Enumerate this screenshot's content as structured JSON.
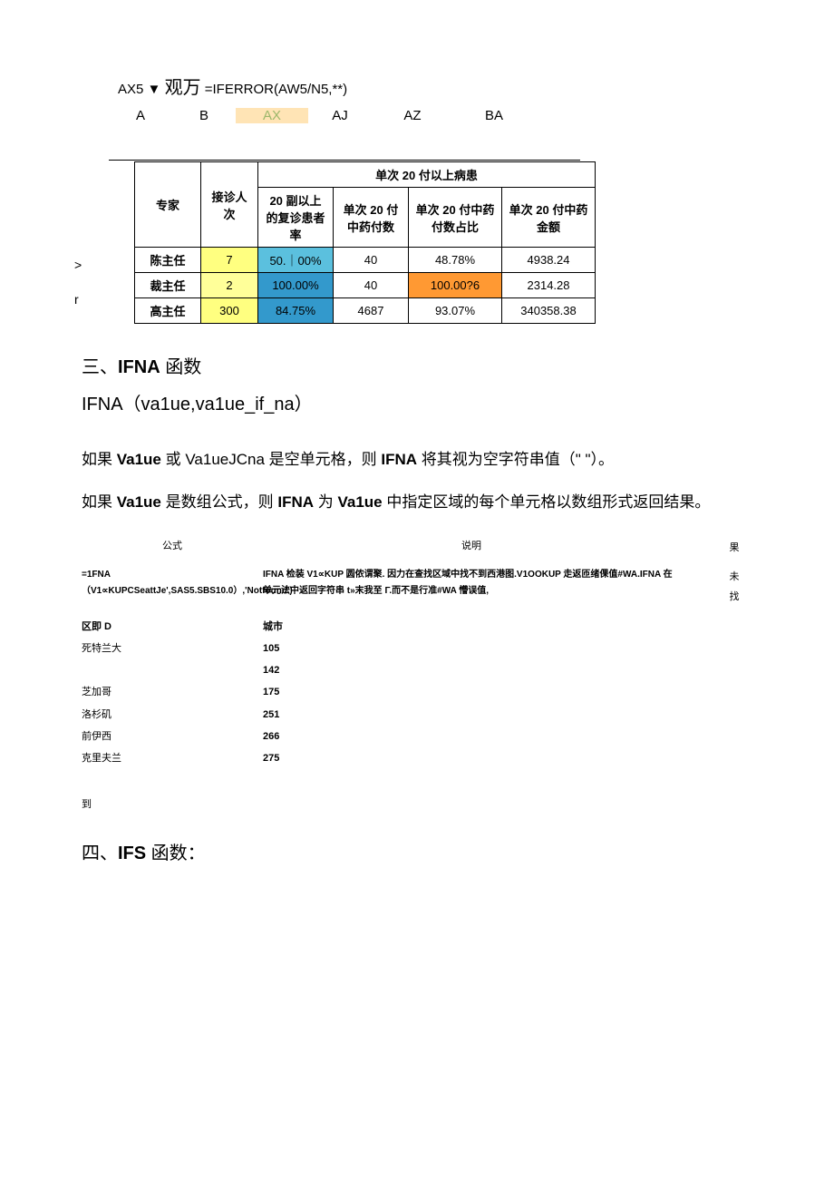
{
  "formula": {
    "cell": "AX5",
    "arrow": "▼",
    "wan_text": "观万",
    "expr": "=IFERROR(AW5/N5,**)"
  },
  "col_headers": {
    "a": "A",
    "b": "B",
    "ax": "AX",
    "aj": "AJ",
    "az": "AZ",
    "ba": "BA"
  },
  "table": {
    "group_header": "单次 20 付以上病患",
    "h_expert": "专家",
    "h_visits": "接诊人次",
    "h_rate20": "20 副以上的复诊患者率",
    "h_times20": "单次 20 付中药付数",
    "h_pct20": "单次 20 付中药付数占比",
    "h_amt20": "单次 20 付中药金额",
    "row_markers": [
      "",
      ">",
      "r"
    ],
    "rows": [
      {
        "expert": "陈主任",
        "visits": "7",
        "rate": "50.｜00%",
        "times": "40",
        "pct": "48.78%",
        "amt": "4938.24"
      },
      {
        "expert": "裁主任",
        "visits": "2",
        "rate": "100.00%",
        "times": "40",
        "pct": "100.00?6",
        "amt": "2314.28"
      },
      {
        "expert": "高主任",
        "visits": "300",
        "rate": "84.75%",
        "times": "4687",
        "pct": "93.07%",
        "amt": "340358.38"
      }
    ]
  },
  "sec3_title_prefix": "三、",
  "sec3_title_bold": "IFNA",
  "sec3_title_suffix": " 函数",
  "sec3_syntax": "IFNA（va1ue,va1ue_if_na）",
  "para1_a": "如果 ",
  "para1_b": "Va1ue",
  "para1_c": " 或 Va1ueJCna 是空单元格，则 ",
  "para1_d": "IFNA",
  "para1_e": " 将其视为空字符串值（\" \"）。",
  "para2_a": "如果 ",
  "para2_b": "Va1ue",
  "para2_c": " 是数组公式，则 ",
  "para2_d": "IFNA",
  "para2_e": " 为 ",
  "para2_f": "Va1ue",
  "para2_g": " 中指定区域的每个单元格以数组形式返回结果。",
  "ifna": {
    "h_formula": "公式",
    "h_desc": "说明",
    "h_result_chars": [
      "果",
      "未",
      "找"
    ],
    "formula": "=1FNA（V1∝KUPCSeattJe',SAS5.SBS10.0）,'Notfound')",
    "desc": "IFNA 检装 V1∝KUP 圆侬谓聚. 因力在查找区域中找不到西港图.V1OOKUP 走返匝绪倮值#WA.IFNA 在单元法中返回字符串 t»末我至 Γ.而不是行准#WA 懵误值,",
    "k_region": "区即 D",
    "k_city": "城市",
    "rows": [
      {
        "k": "死特兰大",
        "v": "105"
      },
      {
        "k": "",
        "v": "142"
      },
      {
        "k": "芝加哥",
        "v": "175"
      },
      {
        "k": "洛杉矶",
        "v": "251"
      },
      {
        "k": "前伊西",
        "v": "266"
      },
      {
        "k": "克里夫兰",
        "v": "275"
      }
    ]
  },
  "dao": "到",
  "sec4_title_prefix": "四、",
  "sec4_title_bold": "IFS",
  "sec4_title_suffix": " 函数："
}
